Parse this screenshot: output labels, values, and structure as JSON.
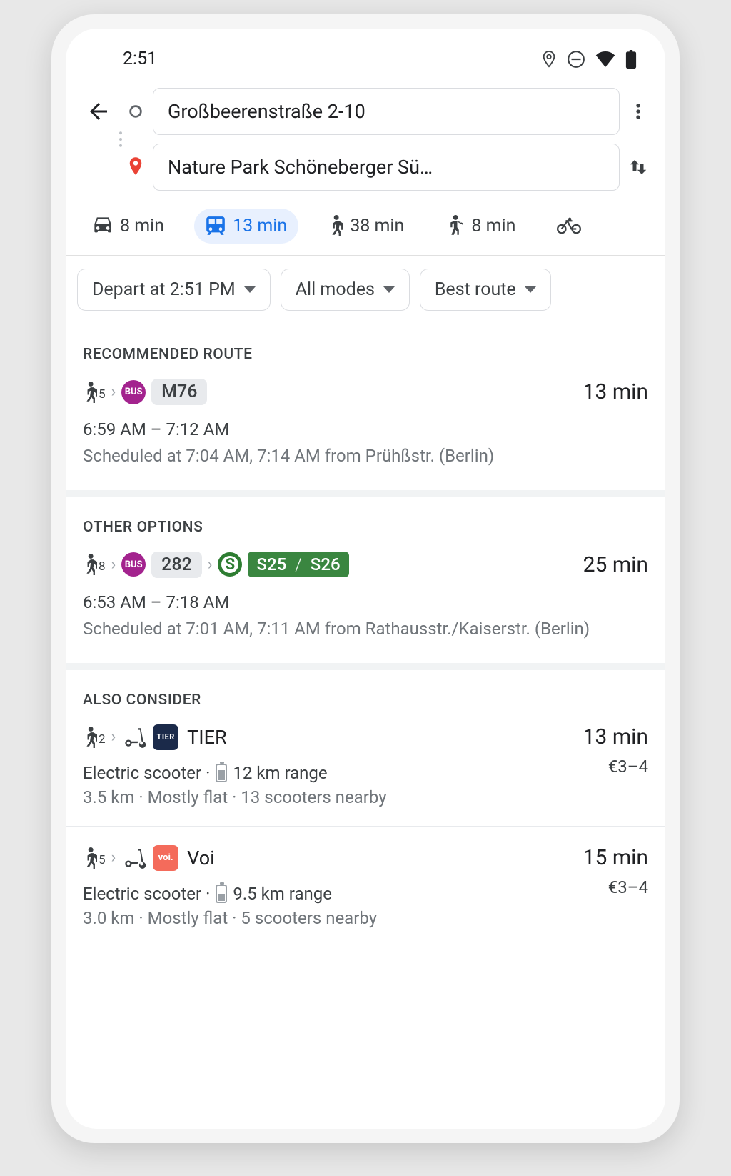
{
  "status": {
    "time": "2:51"
  },
  "header": {
    "origin": "Großbeerenstraße 2-10",
    "destination": "Nature Park Schöneberger Sü…"
  },
  "modes": {
    "car": "8 min",
    "transit": "13 min",
    "walk": "38 min",
    "rideshare": "8 min",
    "bike": ""
  },
  "filters": {
    "depart": "Depart at 2:51 PM",
    "modes": "All modes",
    "sort": "Best route"
  },
  "sections": {
    "recommended": "RECOMMENDED ROUTE",
    "other": "OTHER OPTIONS",
    "also": "ALSO CONSIDER"
  },
  "routes": {
    "rec": {
      "walk": "5",
      "bus_line": "M76",
      "duration": "13 min",
      "time_window": "6:59 AM – 7:12 AM",
      "schedule": "Scheduled at 7:04 AM, 7:14 AM from Prühßstr. (Berlin)"
    },
    "other1": {
      "walk": "8",
      "bus_line": "282",
      "sbahn1": "S25",
      "sbahn2": "S26",
      "duration": "25 min",
      "time_window": "6:53 AM – 7:18 AM",
      "schedule": "Scheduled at 7:01 AM, 7:11 AM from Rathausstr./Kaiserstr. (Berlin)"
    },
    "tier": {
      "walk": "2",
      "brand": "TIER",
      "duration": "13 min",
      "info_prefix": "Electric scooter ·",
      "range": "12 km range",
      "price": "€3–4",
      "meta": "3.5 km · Mostly flat · 13 scooters nearby",
      "battery_pct": 60
    },
    "voi": {
      "walk": "5",
      "brand": "Voi",
      "duration": "15 min",
      "info_prefix": "Electric scooter ·",
      "range": "9.5 km range",
      "price": "€3–4",
      "meta": "3.0 km · Mostly flat · 5 scooters nearby",
      "battery_pct": 45
    }
  }
}
